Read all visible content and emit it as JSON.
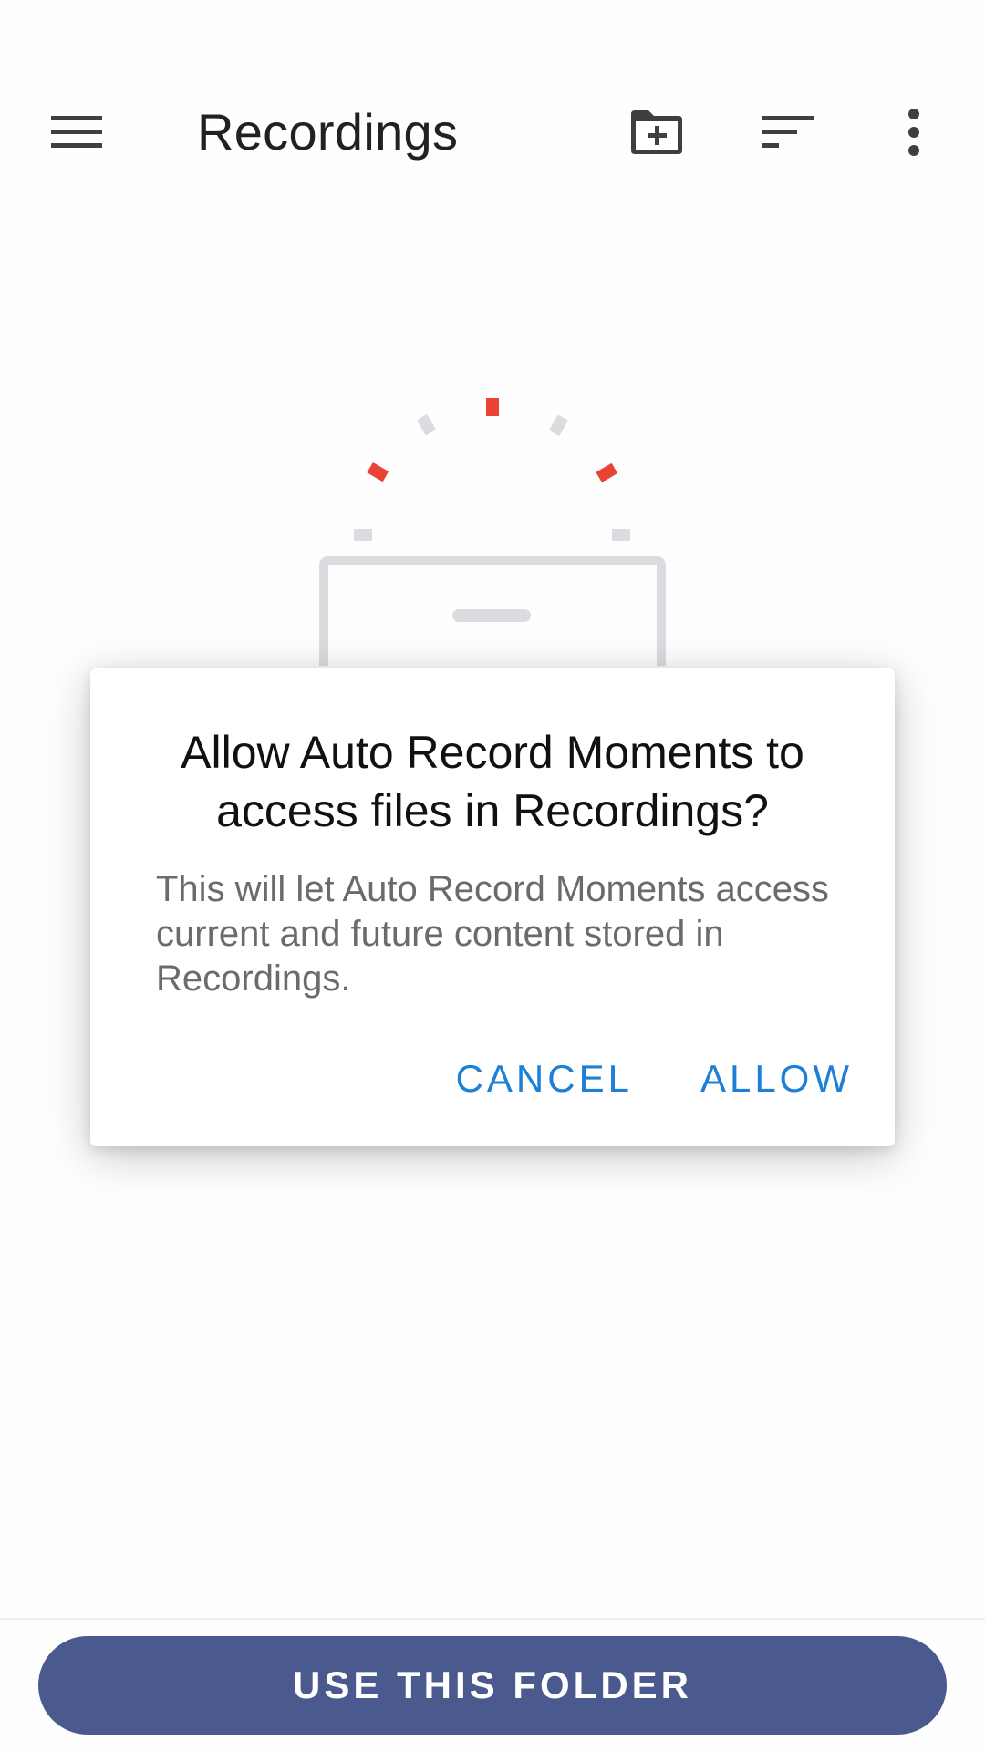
{
  "toolbar": {
    "title": "Recordings",
    "icons": {
      "menu": "hamburger-menu-icon",
      "new_folder": "create-new-folder-icon",
      "sort": "sort-icon",
      "more": "more-vert-icon"
    }
  },
  "dialog": {
    "title": "Allow Auto Record Moments to access files in Recordings?",
    "body": "This will let Auto Record Moments access current and future content stored in Recordings.",
    "cancel_label": "CANCEL",
    "allow_label": "ALLOW"
  },
  "bottom": {
    "use_folder_label": "USE THIS FOLDER"
  },
  "colors": {
    "accent": "#1e7fd6",
    "primary_button": "#4a5a8f",
    "illustration_red": "#ea4335",
    "illustration_gray": "#dadce0",
    "toolbar_icon": "#3c4043"
  }
}
